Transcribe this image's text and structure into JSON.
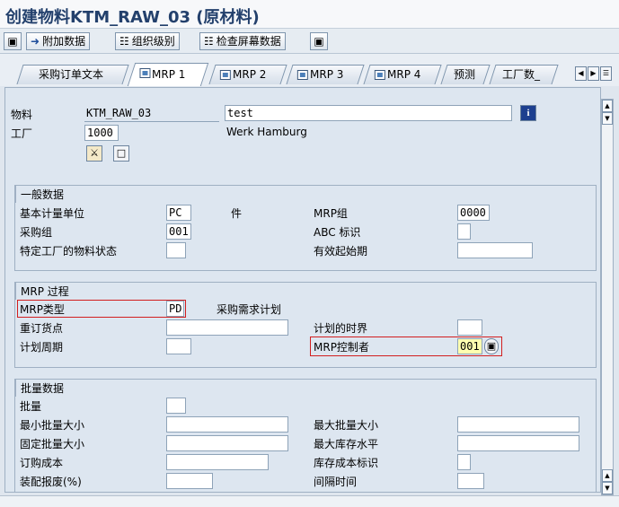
{
  "title": "创建物料KTM_RAW_03 (原材料)",
  "toolbar": {
    "additional_data": "附加数据",
    "org_levels": "组织级别",
    "check_screen_data": "检查屏幕数据"
  },
  "tabs": [
    {
      "label": "采购订单文本",
      "active": false
    },
    {
      "label": "MRP 1",
      "active": true
    },
    {
      "label": "MRP 2",
      "active": false
    },
    {
      "label": "MRP 3",
      "active": false
    },
    {
      "label": "MRP 4",
      "active": false
    },
    {
      "label": "预测",
      "active": false
    },
    {
      "label": "工厂数_",
      "active": false
    }
  ],
  "header": {
    "material_label": "物料",
    "material_value": "KTM_RAW_03",
    "material_desc": "test",
    "plant_label": "工厂",
    "plant_value": "1000",
    "plant_desc": "Werk Hamburg"
  },
  "general": {
    "title": "一般数据",
    "base_uom_label": "基本计量单位",
    "base_uom_value": "PC",
    "base_uom_text": "件",
    "mrp_group_label": "MRP组",
    "mrp_group_value": "0000",
    "purch_group_label": "采购组",
    "purch_group_value": "001",
    "abc_label": "ABC 标识",
    "abc_value": "",
    "plant_status_label": "特定工厂的物料状态",
    "plant_status_value": "",
    "valid_from_label": "有效起始期",
    "valid_from_value": ""
  },
  "mrp_process": {
    "title": "MRP 过程",
    "mrp_type_label": "MRP类型",
    "mrp_type_value": "PD",
    "mrp_type_text": "采购需求计划",
    "reorder_label": "重订货点",
    "reorder_value": "",
    "time_fence_label": "计划的时界",
    "time_fence_value": "",
    "planning_cycle_label": "计划周期",
    "planning_cycle_value": "",
    "controller_label": "MRP控制者",
    "controller_value": "001"
  },
  "lot_size": {
    "title": "批量数据",
    "lot_label": "批量",
    "lot_value": "",
    "min_lot_label": "最小批量大小",
    "min_lot_value": "",
    "max_lot_label": "最大批量大小",
    "max_lot_value": "",
    "fixed_lot_label": "固定批量大小",
    "fixed_lot_value": "",
    "max_stock_label": "最大库存水平",
    "max_stock_value": "",
    "ordering_cost_label": "订购成本",
    "ordering_cost_value": "",
    "storage_cost_label": "库存成本标识",
    "storage_cost_value": "",
    "assembly_scrap_label": "装配报废(%)",
    "assembly_scrap_value": "",
    "interval_label": "间隔时间",
    "interval_value": ""
  },
  "colors": {
    "highlight": "#d21f1f",
    "title_text": "#23406c",
    "active_field": "#ffffb0"
  }
}
